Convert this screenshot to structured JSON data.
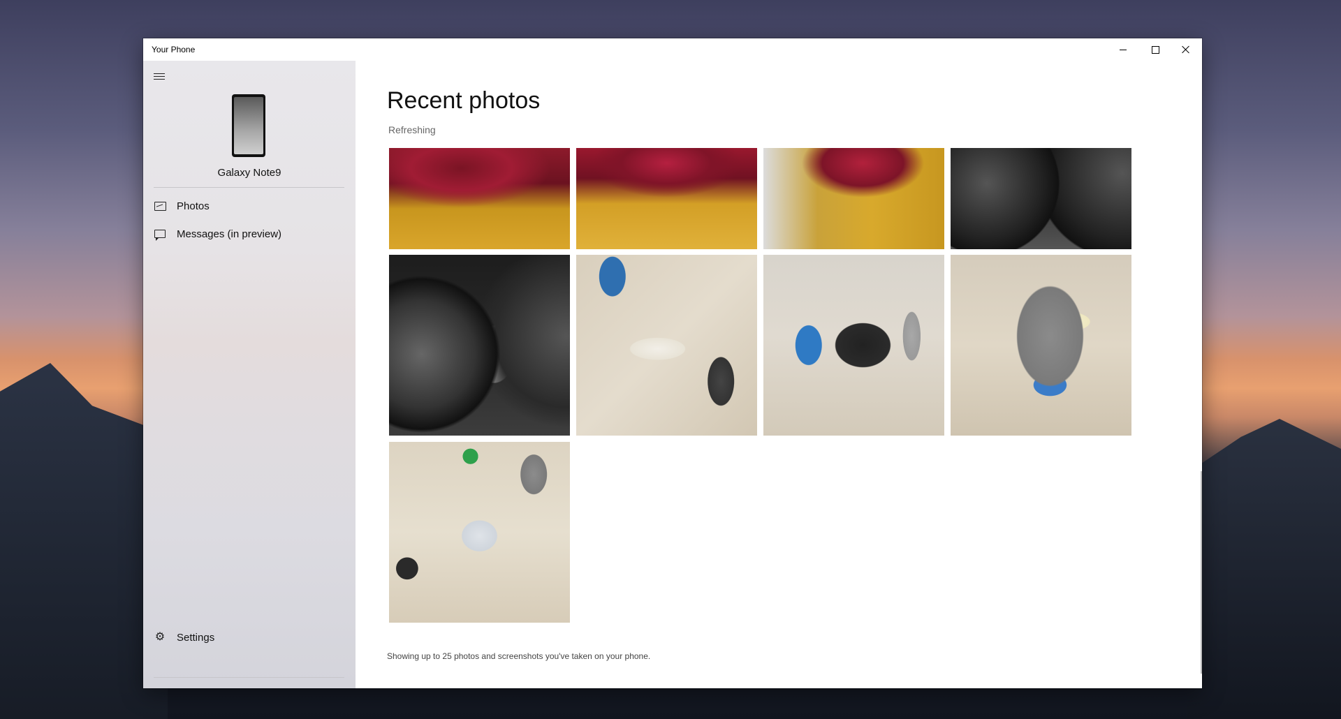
{
  "window": {
    "title": "Your Phone"
  },
  "sidebar": {
    "device_name": "Galaxy Note9",
    "items": [
      {
        "label": "Photos",
        "icon": "photos-icon"
      },
      {
        "label": "Messages (in preview)",
        "icon": "messages-icon"
      }
    ],
    "settings_label": "Settings"
  },
  "main": {
    "title": "Recent photos",
    "status": "Refreshing",
    "footer": "Showing up to 25 photos and screenshots you've taken on your phone.",
    "photos": [
      {
        "subject": "car-taillight",
        "style": "p-car1"
      },
      {
        "subject": "car-taillight",
        "style": "p-car2"
      },
      {
        "subject": "car-taillight",
        "style": "p-car3"
      },
      {
        "subject": "dashboard",
        "style": "p-dash1"
      },
      {
        "subject": "dashboard",
        "style": "p-dash2"
      },
      {
        "subject": "circuit-board",
        "style": "p-pcb1"
      },
      {
        "subject": "circuit-board",
        "style": "p-pcb2"
      },
      {
        "subject": "circuit-board",
        "style": "p-pcb3"
      },
      {
        "subject": "circuit-board",
        "style": "p-pcb4"
      }
    ]
  }
}
